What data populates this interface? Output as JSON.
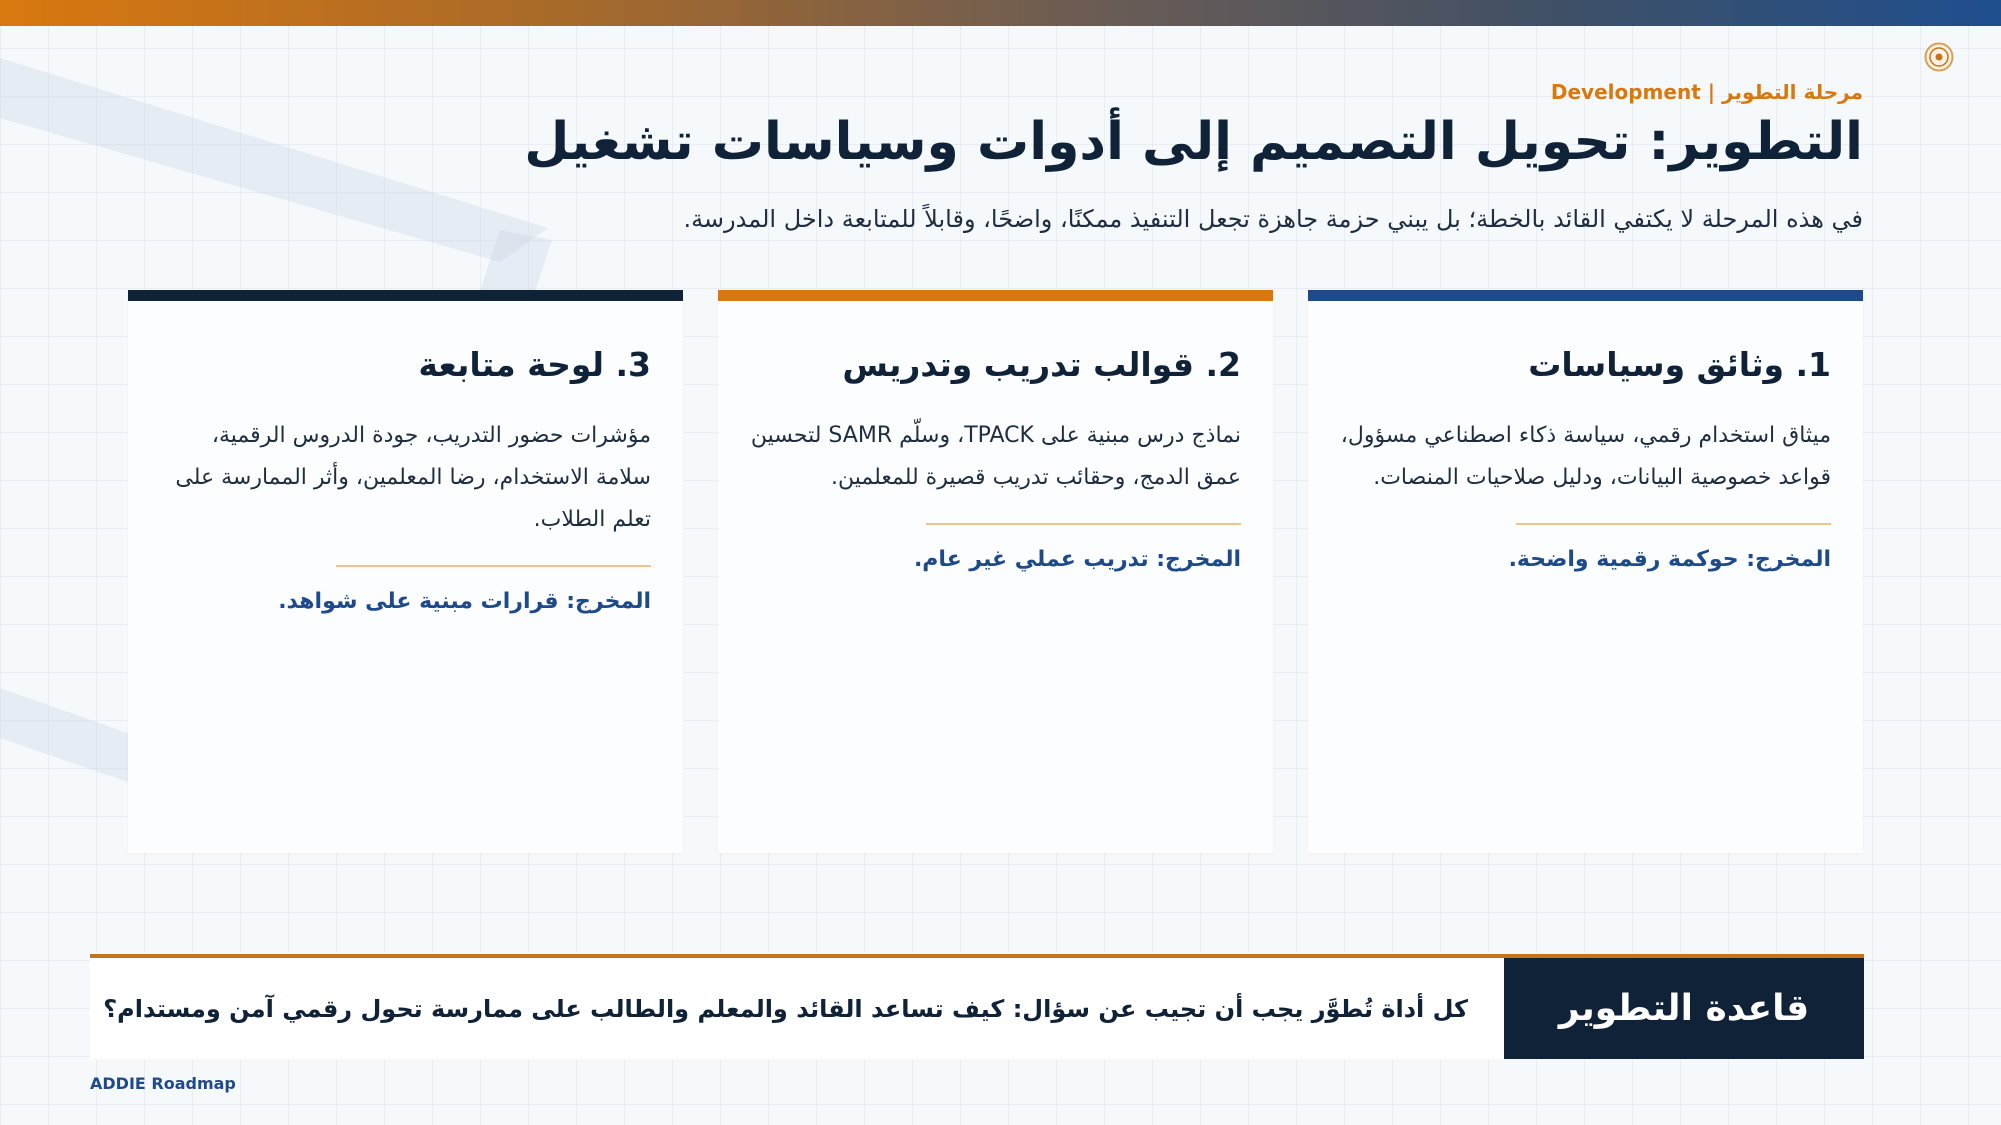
{
  "header": {
    "eyebrow": "مرحلة التطوير | Development",
    "title": "التطوير: تحويل التصميم إلى أدوات وسياسات تشغيل",
    "subtitle": "في هذه المرحلة لا يكتفي القائد بالخطة؛ بل يبني حزمة جاهزة تجعل التنفيذ ممكنًا، واضحًا، وقابلاً للمتابعة داخل المدرسة."
  },
  "cards": [
    {
      "title": "1. وثائق وسياسات",
      "body": "ميثاق استخدام رقمي، سياسة ذكاء اصطناعي مسؤول، قواعد خصوصية البيانات، ودليل صلاحيات المنصات.",
      "output": "المخرج: حوكمة رقمية واضحة.",
      "accent": "#1f4a8a"
    },
    {
      "title": "2. قوالب تدريب وتدريس",
      "body": "نماذج درس مبنية على TPACK، وسلّم SAMR لتحسين عمق الدمج، وحقائب تدريب قصيرة للمعلمين.",
      "output": "المخرج: تدريب عملي غير عام.",
      "accent": "#d9780f"
    },
    {
      "title": "3. لوحة متابعة",
      "body": "مؤشرات حضور التدريب، جودة الدروس الرقمية، سلامة الاستخدام، رضا المعلمين، وأثر الممارسة على تعلم الطلاب.",
      "output": "المخرج: قرارات مبنية على شواهد.",
      "accent": "#0f2237"
    }
  ],
  "rule": {
    "label": "قاعدة التطوير",
    "text": "كل أداة تُطوَّر يجب أن تجيب عن سؤال: كيف تساعد القائد والمعلم والطالب على ممارسة تحول رقمي آمن ومستدام؟"
  },
  "footer": "ADDIE Roadmap",
  "colors": {
    "orange": "#d9780f",
    "navy": "#0f2237",
    "blue": "#1f4a8a",
    "divider": "#f0c48d"
  },
  "icons": {
    "seal": "emblem-seal-icon"
  }
}
